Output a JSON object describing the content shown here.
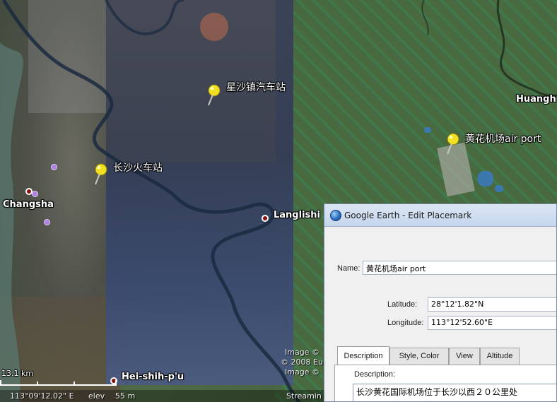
{
  "map": {
    "labels": {
      "xingsha_station": "星沙镇汽车站",
      "changsha_station": "长沙火车站",
      "huanghua_airport": "黄花机场air port",
      "changsha": "Changsha",
      "langlishi": "Langlishi",
      "huangh": "Huangh",
      "heishihpu": "Hei-shih-p'u"
    },
    "watermark": {
      "line1": "Image ©",
      "line2": "© 2008 Eu",
      "line3": "Image ©"
    },
    "scale": "13.1 km",
    "status": {
      "coords": "113°09'12.02\" E",
      "elev": "elev",
      "elev_value": "55 m",
      "streaming": "Streamin"
    },
    "colors": {
      "pin": "#f0e020",
      "dot": "#8a1010"
    }
  },
  "dialog": {
    "title": "Google Earth - Edit Placemark",
    "name_label": "Name:",
    "name_value": "黄花机场air port",
    "latitude_label": "Latitude:",
    "latitude_value": "28°12'1.82\"N",
    "longitude_label": "Longitude:",
    "longitude_value": "113°12'52.60\"E",
    "tabs": [
      "Description",
      "Style, Color",
      "View",
      "Altitude"
    ],
    "description_label": "Description:",
    "description_value": "长沙黄花国际机场位于长沙以西２０公里处"
  }
}
